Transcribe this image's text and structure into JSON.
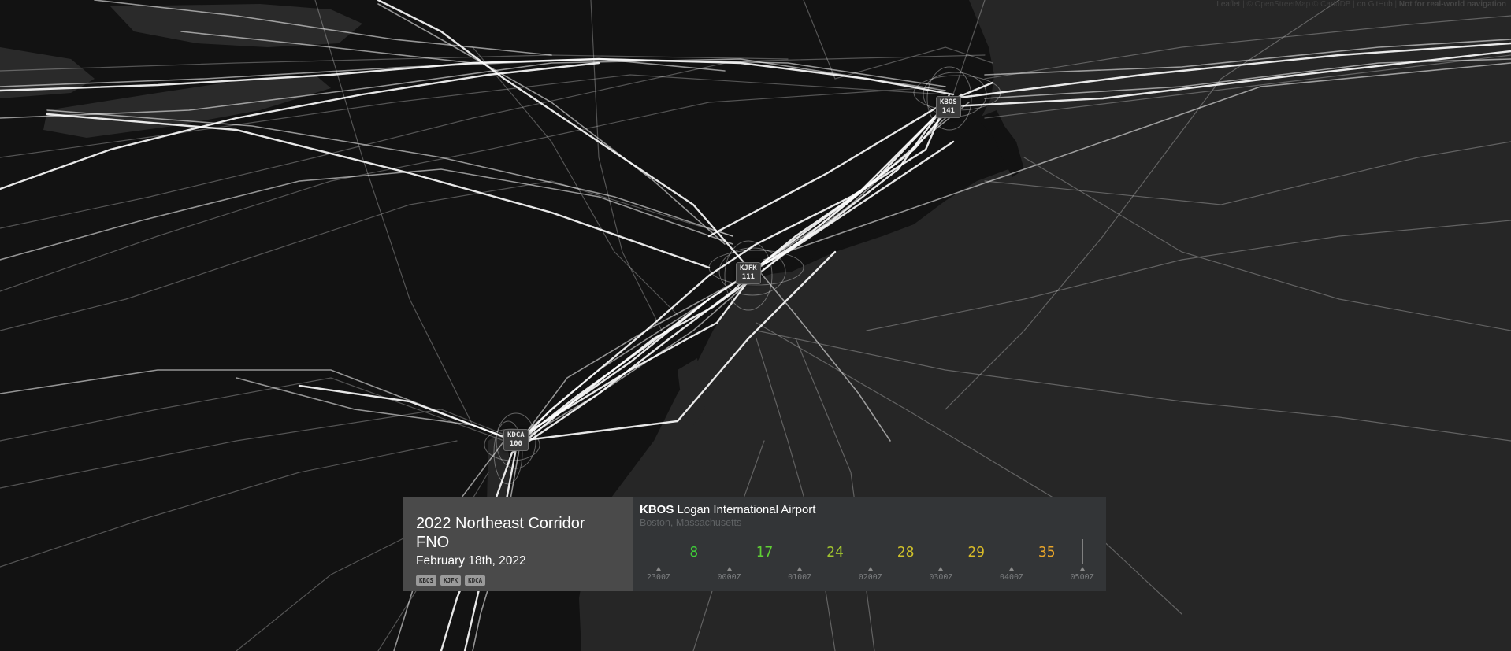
{
  "map": {
    "attribution": {
      "leaflet": "Leaflet",
      "osm": "© OpenStreetMap",
      "carto": "© CartoDB",
      "github": "on GitHub",
      "warning": "Not for real-world navigation"
    },
    "colors": {
      "ocean": "#262626",
      "land": "#121212",
      "lakes": "#2c2c2c",
      "tracks": "#ffffff"
    },
    "airport_markers": [
      {
        "code": "KBOS",
        "count": "141"
      },
      {
        "code": "KJFK",
        "count": "111"
      },
      {
        "code": "KDCA",
        "count": "100"
      }
    ]
  },
  "event": {
    "title": "2022 Northeast Corridor FNO",
    "date": "February 18th, 2022",
    "airports": [
      "KBOS",
      "KJFK",
      "KDCA"
    ]
  },
  "airport_detail": {
    "code": "KBOS",
    "name": "Logan International Airport",
    "city": "Boston, Massachusetts",
    "times": [
      "2300Z",
      "0000Z",
      "0100Z",
      "0200Z",
      "0300Z",
      "0400Z",
      "0500Z"
    ],
    "counts": [
      {
        "value": "8",
        "color": "#3fcf38"
      },
      {
        "value": "17",
        "color": "#5fcf34"
      },
      {
        "value": "24",
        "color": "#a2c52f"
      },
      {
        "value": "28",
        "color": "#cfc12a"
      },
      {
        "value": "29",
        "color": "#d9bb28"
      },
      {
        "value": "35",
        "color": "#e8a52a"
      }
    ]
  }
}
